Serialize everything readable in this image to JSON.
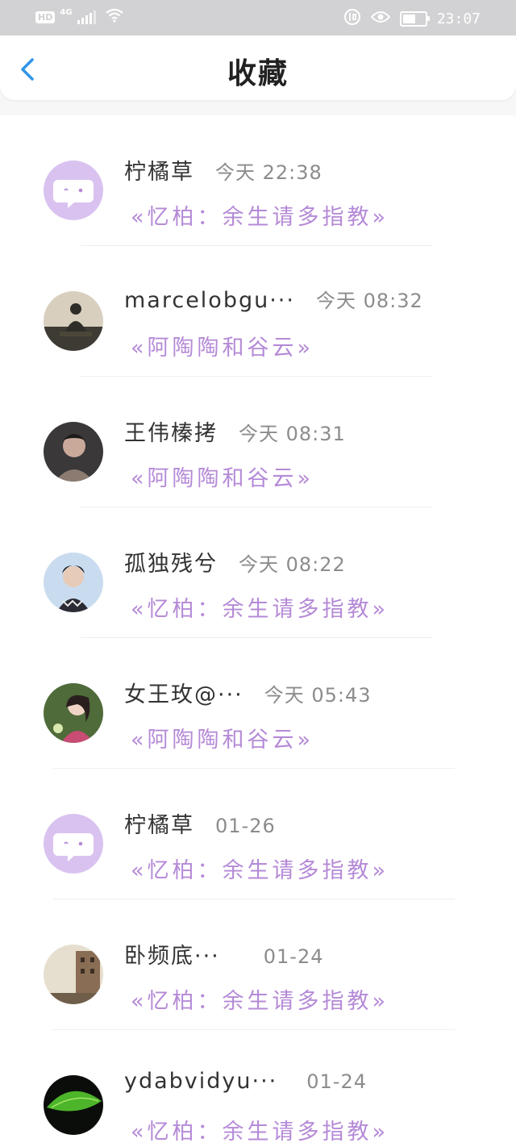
{
  "status_bar": {
    "hd": "HD",
    "network": "4G",
    "time": "23:07",
    "battery_level": 0.7
  },
  "header": {
    "title": "收藏",
    "back_icon": "chevron-left-icon",
    "accent": "#2f95e8"
  },
  "favorites": [
    {
      "name": "柠橘草",
      "time": "今天 22:38",
      "subtitle": "«忆柏：余生请多指教»",
      "avatar": "chat"
    },
    {
      "name": "marcelobgu···",
      "time": "今天 08:32",
      "subtitle": "«阿陶陶和谷云»",
      "avatar": "buddha"
    },
    {
      "name": "王伟榛拷",
      "time": "今天 08:31",
      "subtitle": "«阿陶陶和谷云»",
      "avatar": "person-dark"
    },
    {
      "name": "孤独残兮",
      "time": "今天 08:22",
      "subtitle": "«忆柏：余生请多指教»",
      "avatar": "person-blue"
    },
    {
      "name": "女王玫@···",
      "time": "今天 05:43",
      "subtitle": "«阿陶陶和谷云»",
      "avatar": "person-green"
    },
    {
      "name": "柠橘草",
      "time": "01-26",
      "subtitle": "«忆柏：余生请多指教»",
      "avatar": "chat"
    },
    {
      "name": "卧频底···",
      "time": "01-24",
      "subtitle": "«忆柏：余生请多指教»",
      "avatar": "street"
    },
    {
      "name": "ydabvidyu···",
      "time": "01-24",
      "subtitle": "«忆柏：余生请多指教»",
      "avatar": "leaf"
    }
  ],
  "colors": {
    "subtitle": "#b58ad7",
    "chat_avatar": "#d9c2f0"
  }
}
